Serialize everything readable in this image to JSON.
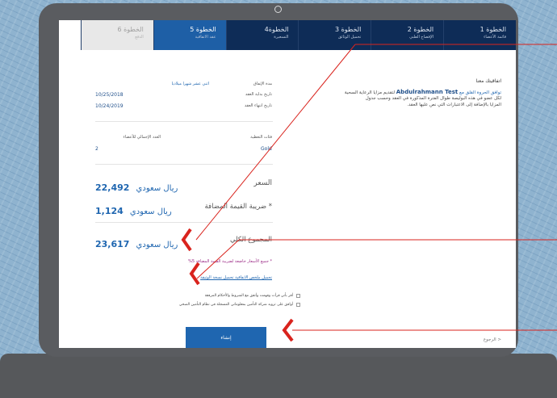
{
  "tabs": [
    {
      "title": "الخطوة 6",
      "subtitle": "الدفع"
    },
    {
      "title": "الخطوة 5",
      "subtitle": "عقد الاتفاقية"
    },
    {
      "title": "الخطوة4",
      "subtitle": "التسعيرة"
    },
    {
      "title": "الخطوة 3",
      "subtitle": "تحميل الوثائق"
    },
    {
      "title": "الخطوة 2",
      "subtitle": "الإفصاح الطبي"
    },
    {
      "title": "الخطوة 1",
      "subtitle": "قائمة الأعضاء"
    }
  ],
  "agreement": {
    "heading": "اتفاقيتك معنا",
    "intro": "توافق الحروة القلق مع",
    "company": "Abdulrahmann Test",
    "line1_end": "لتقديم مزايا الرعاية السحية",
    "line2": "لكل عضو في هذه البوليصة طوال الفترة المذكورة في العقد وحسب جدول",
    "line3": "المزايا بالإضافة إلى الاعتبارات التي نص عليها العقد."
  },
  "details": {
    "duration_label": "مدة الإتفاق",
    "duration_value": "اثني عشر شهرا ميلاديا",
    "start_label": "تاريخ بداية العقد",
    "start_value": "10/25/2018",
    "end_label": "تاريخ انتهاء العقد",
    "end_value": "10/24/2019",
    "class_label": "فئات التغطية",
    "class_value": "Gold",
    "members_label": "العدد الإجمالي للأعضاء",
    "members_value": "2"
  },
  "pricing": {
    "price_label": "السعر",
    "price_value": "22,492",
    "vat_label": "* ضريبة القيمة المضافة",
    "vat_value": "1,124",
    "total_label": "المجموع الكلي",
    "total_value": "23,617",
    "currency": "ريال سعودي"
  },
  "notes": {
    "vat_note": "* جميع الأسعار خاضعة لضريبة القيمة المضافة 5%",
    "links": "تحميل ملخص الاتفاقية    تحميل نسخة الوثيقة"
  },
  "checkboxes": [
    "أقر بأني قرأت وفهمت وأتفق مع الشروط والأحكام المرفقة",
    "أوافق على تزويد شركة التأمين بمعلوماتي المسجلة في نظام التأمين الصحي"
  ],
  "buttons": {
    "submit": "إنشاء",
    "back": "< الرجوع"
  },
  "colors": {
    "navy": "#0e2c57",
    "active_tab": "#1e5fa6",
    "accent": "#1f66b0",
    "annotation": "#d9231d",
    "note": "#9b2a86"
  }
}
